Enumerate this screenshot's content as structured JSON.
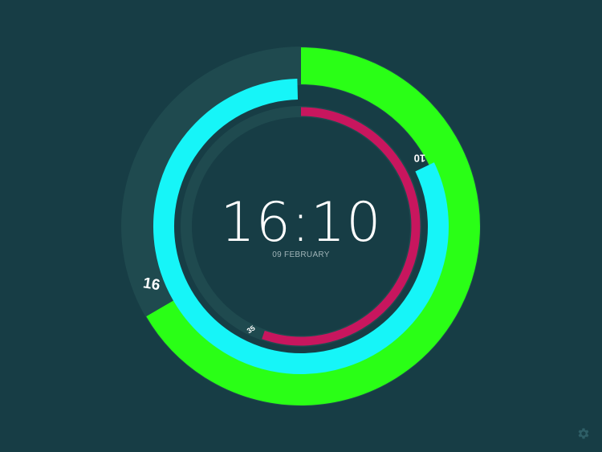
{
  "time": "16:10",
  "date": "09 FEBRUARY",
  "rings": {
    "hours": {
      "value": "16",
      "fraction": 0.6667,
      "color": "#2aff16"
    },
    "minutes": {
      "value": "10",
      "fraction": 0.1667,
      "color": "#16f5f8"
    },
    "seconds": {
      "value": "35",
      "fraction": 0.5833,
      "color": "#c8165e"
    }
  },
  "colors": {
    "background": "#173d45",
    "track": "#1f4a4f",
    "text": "#ffffff",
    "date_text": "#9fb3b7"
  },
  "icons": {
    "settings": "gear-icon"
  }
}
